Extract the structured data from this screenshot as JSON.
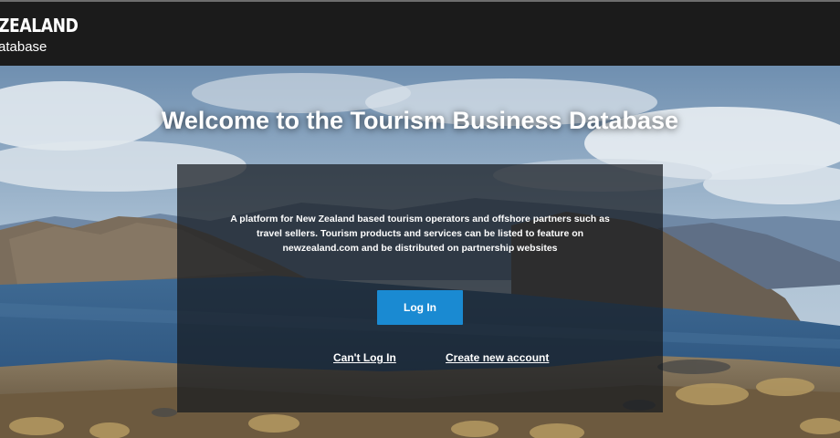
{
  "header": {
    "brand_line1": "ZEALAND",
    "brand_line2": "atabase"
  },
  "hero": {
    "title": "Welcome to the Tourism Business Database",
    "description": "A platform for New Zealand based tourism operators and offshore partners such as travel sellers. Tourism products and services can be listed to feature on newzealand.com and be distributed on partnership websites",
    "login_label": "Log In",
    "cant_login_label": "Can't Log In",
    "create_account_label": "Create new account"
  },
  "colors": {
    "header_bg": "#1b1b1b",
    "button_blue": "#1a8ad2",
    "panel_overlay": "rgba(22,26,32,0.72)"
  }
}
